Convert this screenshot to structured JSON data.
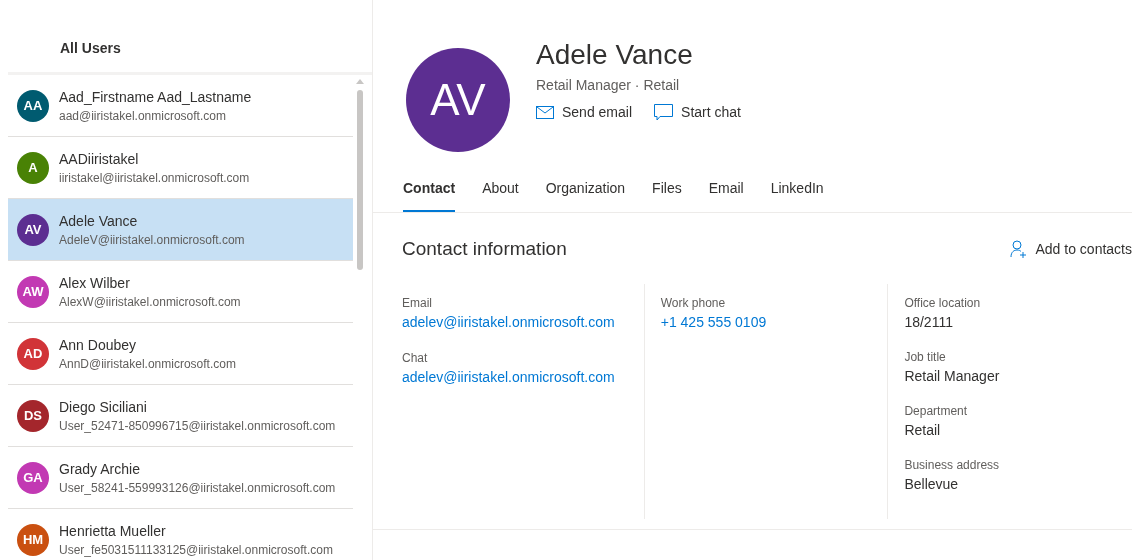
{
  "sidebar": {
    "title": "All Users",
    "users": [
      {
        "initials": "AA",
        "name": "Aad_Firstname Aad_Lastname",
        "email": "aad@iiristakel.onmicrosoft.com",
        "color": "#005b70",
        "selected": false
      },
      {
        "initials": "A",
        "name": "AADiiristakel",
        "email": "iiristakel@iiristakel.onmicrosoft.com",
        "color": "#498205",
        "selected": false
      },
      {
        "initials": "AV",
        "name": "Adele Vance",
        "email": "AdeleV@iiristakel.onmicrosoft.com",
        "color": "#5c2e91",
        "selected": true
      },
      {
        "initials": "AW",
        "name": "Alex Wilber",
        "email": "AlexW@iiristakel.onmicrosoft.com",
        "color": "#c239b3",
        "selected": false
      },
      {
        "initials": "AD",
        "name": "Ann Doubey",
        "email": "AnnD@iiristakel.onmicrosoft.com",
        "color": "#d13438",
        "selected": false
      },
      {
        "initials": "DS",
        "name": "Diego Siciliani",
        "email": "User_52471-850996715@iiristakel.onmicrosoft.com",
        "color": "#a4262c",
        "selected": false
      },
      {
        "initials": "GA",
        "name": "Grady Archie",
        "email": "User_58241-559993126@iiristakel.onmicrosoft.com",
        "color": "#c239b3",
        "selected": false
      },
      {
        "initials": "HM",
        "name": "Henrietta Mueller",
        "email": "User_fe5031511133125@iiristakel.onmicrosoft.com",
        "color": "#ca5010",
        "selected": false
      }
    ]
  },
  "profile": {
    "initials": "AV",
    "color": "#5c2e91",
    "name": "Adele Vance",
    "job_title": "Retail Manager",
    "department": "Retail",
    "separator": "·",
    "actions": [
      {
        "kind": "email",
        "label": "Send email"
      },
      {
        "kind": "chat",
        "label": "Start chat"
      }
    ]
  },
  "tabs": [
    {
      "label": "Contact",
      "selected": true
    },
    {
      "label": "About",
      "selected": false
    },
    {
      "label": "Organization",
      "selected": false
    },
    {
      "label": "Files",
      "selected": false
    },
    {
      "label": "Email",
      "selected": false
    },
    {
      "label": "LinkedIn",
      "selected": false
    }
  ],
  "contact": {
    "title": "Contact information",
    "add_button": "Add to contacts",
    "columns": [
      [
        {
          "label": "Email",
          "value": "adelev@iiristakel.onmicrosoft.com",
          "kind": "link"
        },
        {
          "label": "Chat",
          "value": "adelev@iiristakel.onmicrosoft.com",
          "kind": "link"
        }
      ],
      [
        {
          "label": "Work phone",
          "value": "+1 425 555 0109",
          "kind": "link"
        }
      ],
      [
        {
          "label": "Office location",
          "value": "18/2111",
          "kind": "text"
        },
        {
          "label": "Job title",
          "value": "Retail Manager",
          "kind": "text"
        },
        {
          "label": "Department",
          "value": "Retail",
          "kind": "text"
        },
        {
          "label": "Business address",
          "value": "Bellevue",
          "kind": "text"
        }
      ]
    ]
  }
}
